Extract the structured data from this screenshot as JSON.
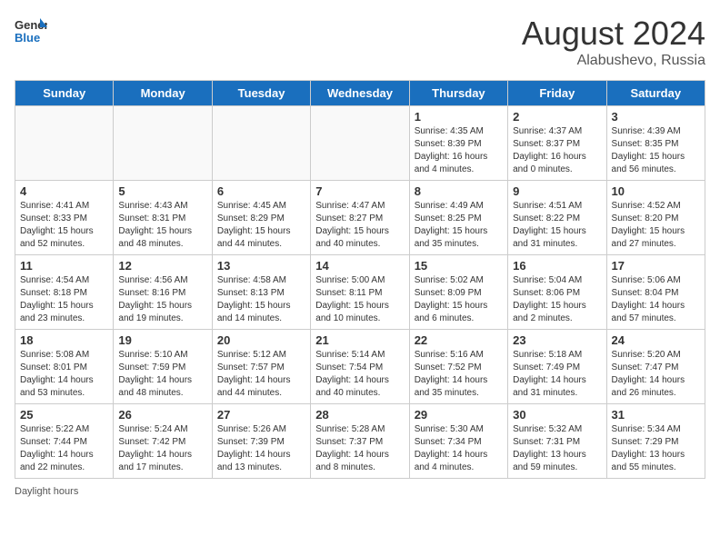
{
  "header": {
    "logo_general": "General",
    "logo_blue": "Blue",
    "month_year": "August 2024",
    "location": "Alabushevo, Russia"
  },
  "days_of_week": [
    "Sunday",
    "Monday",
    "Tuesday",
    "Wednesday",
    "Thursday",
    "Friday",
    "Saturday"
  ],
  "footer": {
    "daylight_label": "Daylight hours"
  },
  "weeks": [
    {
      "days": [
        {
          "num": "",
          "info": ""
        },
        {
          "num": "",
          "info": ""
        },
        {
          "num": "",
          "info": ""
        },
        {
          "num": "",
          "info": ""
        },
        {
          "num": "1",
          "info": "Sunrise: 4:35 AM\nSunset: 8:39 PM\nDaylight: 16 hours\nand 4 minutes."
        },
        {
          "num": "2",
          "info": "Sunrise: 4:37 AM\nSunset: 8:37 PM\nDaylight: 16 hours\nand 0 minutes."
        },
        {
          "num": "3",
          "info": "Sunrise: 4:39 AM\nSunset: 8:35 PM\nDaylight: 15 hours\nand 56 minutes."
        }
      ]
    },
    {
      "days": [
        {
          "num": "4",
          "info": "Sunrise: 4:41 AM\nSunset: 8:33 PM\nDaylight: 15 hours\nand 52 minutes."
        },
        {
          "num": "5",
          "info": "Sunrise: 4:43 AM\nSunset: 8:31 PM\nDaylight: 15 hours\nand 48 minutes."
        },
        {
          "num": "6",
          "info": "Sunrise: 4:45 AM\nSunset: 8:29 PM\nDaylight: 15 hours\nand 44 minutes."
        },
        {
          "num": "7",
          "info": "Sunrise: 4:47 AM\nSunset: 8:27 PM\nDaylight: 15 hours\nand 40 minutes."
        },
        {
          "num": "8",
          "info": "Sunrise: 4:49 AM\nSunset: 8:25 PM\nDaylight: 15 hours\nand 35 minutes."
        },
        {
          "num": "9",
          "info": "Sunrise: 4:51 AM\nSunset: 8:22 PM\nDaylight: 15 hours\nand 31 minutes."
        },
        {
          "num": "10",
          "info": "Sunrise: 4:52 AM\nSunset: 8:20 PM\nDaylight: 15 hours\nand 27 minutes."
        }
      ]
    },
    {
      "days": [
        {
          "num": "11",
          "info": "Sunrise: 4:54 AM\nSunset: 8:18 PM\nDaylight: 15 hours\nand 23 minutes."
        },
        {
          "num": "12",
          "info": "Sunrise: 4:56 AM\nSunset: 8:16 PM\nDaylight: 15 hours\nand 19 minutes."
        },
        {
          "num": "13",
          "info": "Sunrise: 4:58 AM\nSunset: 8:13 PM\nDaylight: 15 hours\nand 14 minutes."
        },
        {
          "num": "14",
          "info": "Sunrise: 5:00 AM\nSunset: 8:11 PM\nDaylight: 15 hours\nand 10 minutes."
        },
        {
          "num": "15",
          "info": "Sunrise: 5:02 AM\nSunset: 8:09 PM\nDaylight: 15 hours\nand 6 minutes."
        },
        {
          "num": "16",
          "info": "Sunrise: 5:04 AM\nSunset: 8:06 PM\nDaylight: 15 hours\nand 2 minutes."
        },
        {
          "num": "17",
          "info": "Sunrise: 5:06 AM\nSunset: 8:04 PM\nDaylight: 14 hours\nand 57 minutes."
        }
      ]
    },
    {
      "days": [
        {
          "num": "18",
          "info": "Sunrise: 5:08 AM\nSunset: 8:01 PM\nDaylight: 14 hours\nand 53 minutes."
        },
        {
          "num": "19",
          "info": "Sunrise: 5:10 AM\nSunset: 7:59 PM\nDaylight: 14 hours\nand 48 minutes."
        },
        {
          "num": "20",
          "info": "Sunrise: 5:12 AM\nSunset: 7:57 PM\nDaylight: 14 hours\nand 44 minutes."
        },
        {
          "num": "21",
          "info": "Sunrise: 5:14 AM\nSunset: 7:54 PM\nDaylight: 14 hours\nand 40 minutes."
        },
        {
          "num": "22",
          "info": "Sunrise: 5:16 AM\nSunset: 7:52 PM\nDaylight: 14 hours\nand 35 minutes."
        },
        {
          "num": "23",
          "info": "Sunrise: 5:18 AM\nSunset: 7:49 PM\nDaylight: 14 hours\nand 31 minutes."
        },
        {
          "num": "24",
          "info": "Sunrise: 5:20 AM\nSunset: 7:47 PM\nDaylight: 14 hours\nand 26 minutes."
        }
      ]
    },
    {
      "days": [
        {
          "num": "25",
          "info": "Sunrise: 5:22 AM\nSunset: 7:44 PM\nDaylight: 14 hours\nand 22 minutes."
        },
        {
          "num": "26",
          "info": "Sunrise: 5:24 AM\nSunset: 7:42 PM\nDaylight: 14 hours\nand 17 minutes."
        },
        {
          "num": "27",
          "info": "Sunrise: 5:26 AM\nSunset: 7:39 PM\nDaylight: 14 hours\nand 13 minutes."
        },
        {
          "num": "28",
          "info": "Sunrise: 5:28 AM\nSunset: 7:37 PM\nDaylight: 14 hours\nand 8 minutes."
        },
        {
          "num": "29",
          "info": "Sunrise: 5:30 AM\nSunset: 7:34 PM\nDaylight: 14 hours\nand 4 minutes."
        },
        {
          "num": "30",
          "info": "Sunrise: 5:32 AM\nSunset: 7:31 PM\nDaylight: 13 hours\nand 59 minutes."
        },
        {
          "num": "31",
          "info": "Sunrise: 5:34 AM\nSunset: 7:29 PM\nDaylight: 13 hours\nand 55 minutes."
        }
      ]
    }
  ]
}
